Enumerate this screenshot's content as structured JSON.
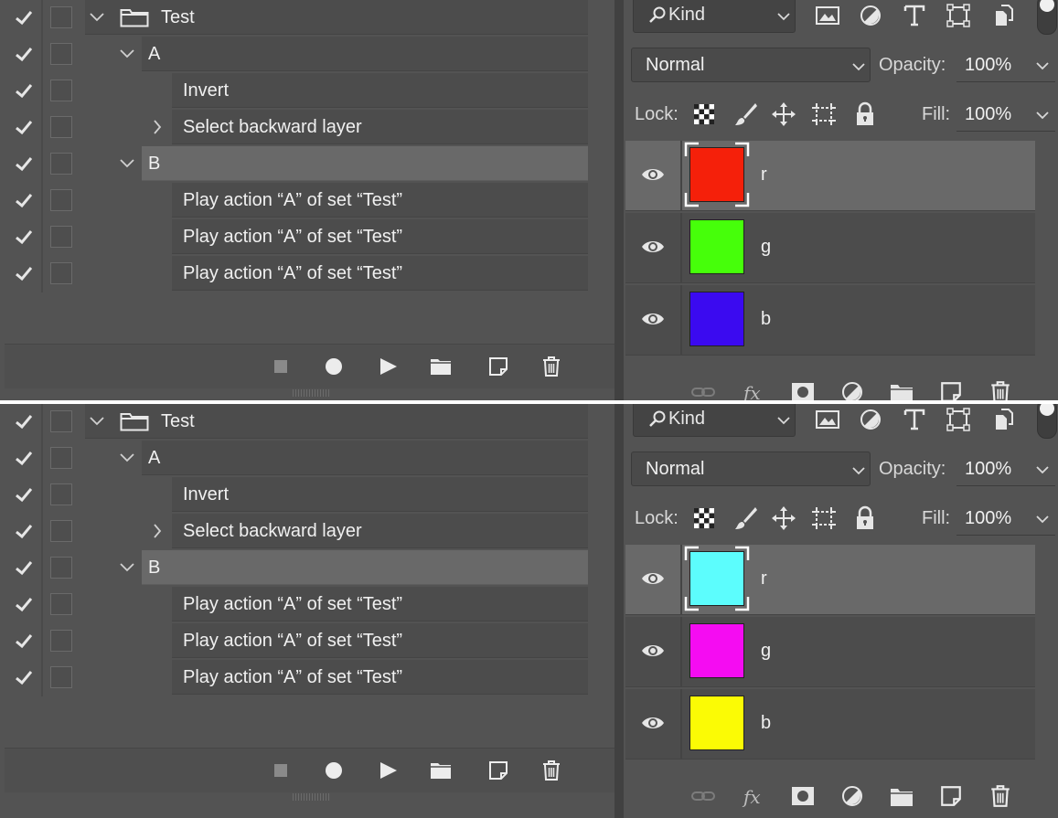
{
  "screens": [
    {
      "actions": [
        {
          "label": "Test",
          "level": 0,
          "expanded": true,
          "folder": true,
          "selected": false
        },
        {
          "label": "A",
          "level": 1,
          "expanded": true,
          "folder": false,
          "selected": false
        },
        {
          "label": "Invert",
          "level": 2,
          "expandable": false,
          "selected": false
        },
        {
          "label": "Select backward layer",
          "level": 2,
          "expandable": true,
          "expanded": false,
          "selected": false
        },
        {
          "label": "B",
          "level": 1,
          "expanded": true,
          "folder": false,
          "selected": true
        },
        {
          "label": "Play action “A” of set “Test”",
          "level": 2,
          "expandable": false,
          "selected": false
        },
        {
          "label": "Play action “A” of set “Test”",
          "level": 2,
          "expandable": false,
          "selected": false
        },
        {
          "label": "Play action “A” of set “Test”",
          "level": 2,
          "expandable": false,
          "selected": false
        }
      ],
      "layers_panel": {
        "filter_kind": "Kind",
        "blend_mode": "Normal",
        "opacity_label": "Opacity:",
        "opacity_value": "100%",
        "lock_label": "Lock:",
        "fill_label": "Fill:",
        "fill_value": "100%",
        "layers": [
          {
            "name": "r",
            "color": "#f5200a",
            "selected": true
          },
          {
            "name": "g",
            "color": "#46ff0a",
            "selected": false
          },
          {
            "name": "b",
            "color": "#3b0af0",
            "selected": false
          }
        ]
      }
    },
    {
      "actions": [
        {
          "label": "Test",
          "level": 0,
          "expanded": true,
          "folder": true,
          "selected": false
        },
        {
          "label": "A",
          "level": 1,
          "expanded": true,
          "folder": false,
          "selected": false
        },
        {
          "label": "Invert",
          "level": 2,
          "expandable": false,
          "selected": false
        },
        {
          "label": "Select backward layer",
          "level": 2,
          "expandable": true,
          "expanded": false,
          "selected": false
        },
        {
          "label": "B",
          "level": 1,
          "expanded": true,
          "folder": false,
          "selected": true
        },
        {
          "label": "Play action “A” of set “Test”",
          "level": 2,
          "expandable": false,
          "selected": false
        },
        {
          "label": "Play action “A” of set “Test”",
          "level": 2,
          "expandable": false,
          "selected": false
        },
        {
          "label": "Play action “A” of set “Test”",
          "level": 2,
          "expandable": false,
          "selected": false
        }
      ],
      "layers_panel": {
        "filter_kind": "Kind",
        "blend_mode": "Normal",
        "opacity_label": "Opacity:",
        "opacity_value": "100%",
        "lock_label": "Lock:",
        "fill_label": "Fill:",
        "fill_value": "100%",
        "layers": [
          {
            "name": "r",
            "color": "#5cfdfd",
            "selected": true
          },
          {
            "name": "g",
            "color": "#f50cf2",
            "selected": false
          },
          {
            "name": "b",
            "color": "#fbfb05",
            "selected": false
          }
        ]
      }
    }
  ],
  "icons": {
    "actions_footer": [
      "stop-icon",
      "record-icon",
      "play-icon",
      "new-set-folder-icon",
      "new-action-icon",
      "trash-icon"
    ],
    "layers_toolbar": [
      "image-filter-icon",
      "adjustment-filter-icon",
      "type-filter-icon",
      "shape-filter-icon",
      "smart-object-filter-icon"
    ],
    "lock": [
      "lock-transparent-icon",
      "lock-paint-icon",
      "lock-position-icon",
      "lock-artboard-icon",
      "lock-all-icon"
    ],
    "layers_footer": [
      "link-icon",
      "fx-icon",
      "mask-icon",
      "adjustment-icon",
      "group-folder-icon",
      "new-layer-icon",
      "trash-icon"
    ]
  },
  "colors": {
    "panel_bg": "#535353",
    "row_bg": "#4c4c4c",
    "row_selected": "#696969",
    "separator": "#ffffff"
  }
}
